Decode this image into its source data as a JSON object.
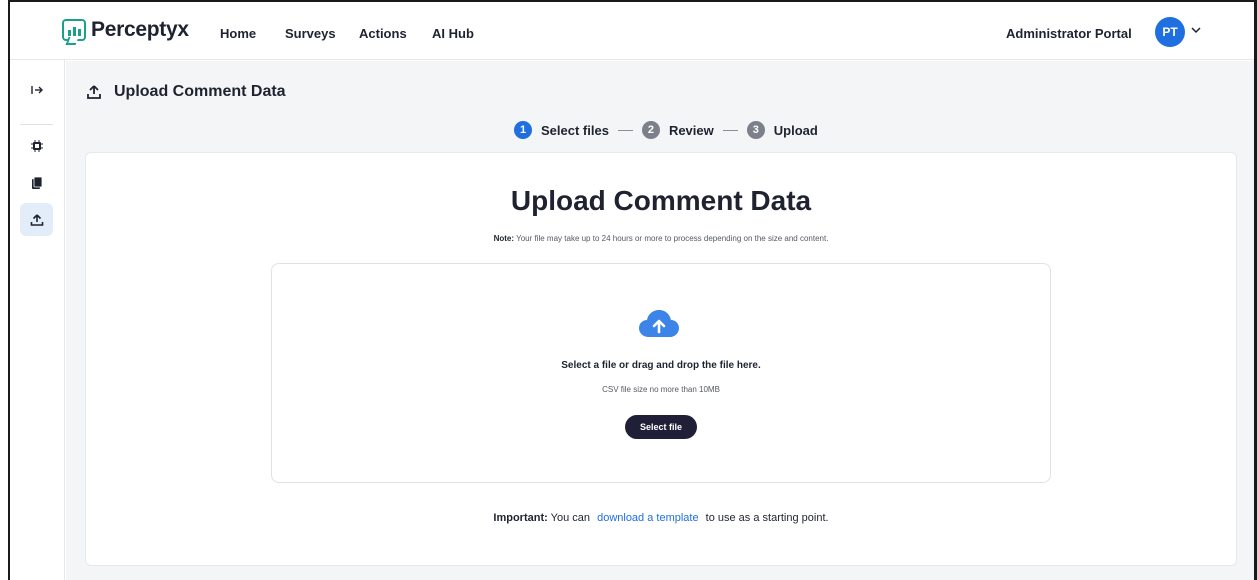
{
  "brand": {
    "name": "Perceptyx"
  },
  "nav": {
    "links": [
      "Home",
      "Surveys",
      "Actions",
      "AI Hub"
    ],
    "portal": "Administrator Portal",
    "avatar_initials": "PT"
  },
  "page": {
    "header_title": "Upload Comment Data"
  },
  "stepper": {
    "steps": [
      {
        "num": "1",
        "label": "Select files",
        "active": true
      },
      {
        "num": "2",
        "label": "Review",
        "active": false
      },
      {
        "num": "3",
        "label": "Upload",
        "active": false
      }
    ]
  },
  "card": {
    "title": "Upload Comment Data",
    "note_label": "Note:",
    "note_text": "Your file may take up to 24 hours or more to process depending on the size and content.",
    "drop_main": "Select a file or drag and drop the file here.",
    "drop_sub": "CSV file size no more than 10MB",
    "select_button": "Select file",
    "important_label": "Important:",
    "important_pre": "You can",
    "important_link": "download a template",
    "important_post": "to use as a starting point."
  },
  "icons": {
    "sidebar": [
      "expand-icon",
      "chip-icon",
      "copy-icon",
      "upload-icon"
    ],
    "cloud": "cloud-upload-icon"
  },
  "colors": {
    "accent": "#1f6fe0",
    "brand": "#1aa08b",
    "button_dark": "#1f2037",
    "active_rail": "#e2edf9"
  }
}
